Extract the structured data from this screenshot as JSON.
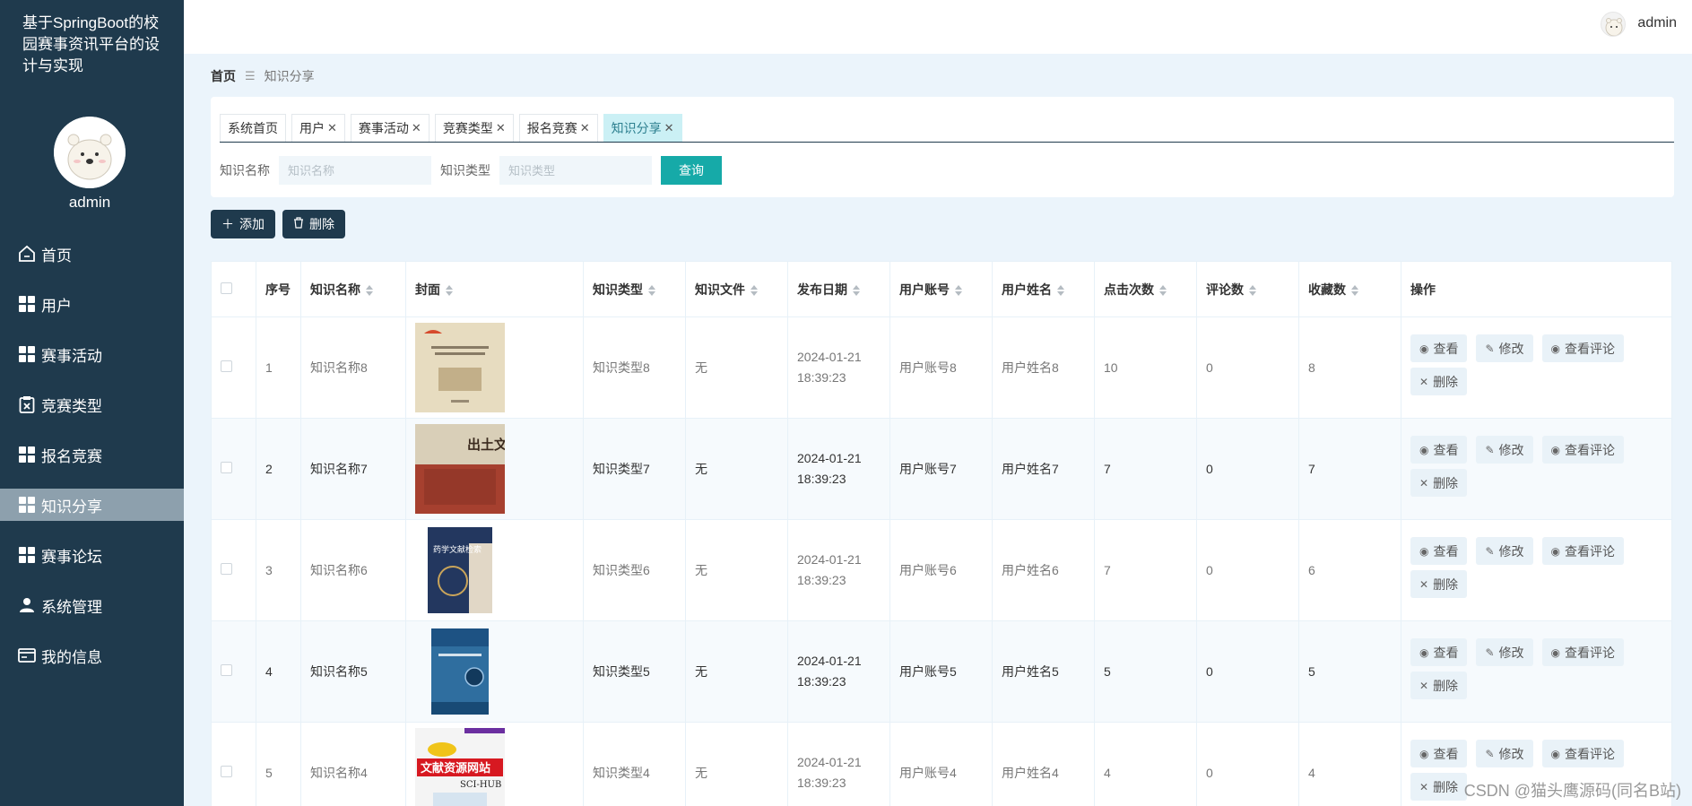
{
  "sidebar": {
    "system_title": "基于SpringBoot的校园赛事资讯平台的设计与实现",
    "username": "admin",
    "menu": [
      {
        "label": "首页",
        "icon": "home-icon"
      },
      {
        "label": "用户",
        "icon": "grid-icon"
      },
      {
        "label": "赛事活动",
        "icon": "grid-icon"
      },
      {
        "label": "竞赛类型",
        "icon": "clipboard-icon"
      },
      {
        "label": "报名竞赛",
        "icon": "grid-icon"
      },
      {
        "label": "知识分享",
        "icon": "grid-icon",
        "active": true
      },
      {
        "label": "赛事论坛",
        "icon": "grid-icon"
      },
      {
        "label": "系统管理",
        "icon": "user-icon"
      },
      {
        "label": "我的信息",
        "icon": "card-icon"
      }
    ]
  },
  "topbar": {
    "username": "admin"
  },
  "breadcrumb": {
    "home": "首页",
    "separator": "☰",
    "current": "知识分享"
  },
  "tabs": [
    {
      "label": "系统首页",
      "closable": false
    },
    {
      "label": "用户",
      "closable": true
    },
    {
      "label": "赛事活动",
      "closable": true
    },
    {
      "label": "竞赛类型",
      "closable": true
    },
    {
      "label": "报名竞赛",
      "closable": true
    },
    {
      "label": "知识分享",
      "closable": true,
      "active": true
    }
  ],
  "search": {
    "name_label": "知识名称",
    "name_placeholder": "知识名称",
    "type_label": "知识类型",
    "type_placeholder": "知识类型",
    "query_label": "查询"
  },
  "actions": {
    "add_label": "添加",
    "delete_label": "删除"
  },
  "table": {
    "headers": [
      "序号",
      "知识名称",
      "封面",
      "知识类型",
      "知识文件",
      "发布日期",
      "用户账号",
      "用户姓名",
      "点击次数",
      "评论数",
      "收藏数",
      "操作"
    ],
    "op_labels": {
      "view": "查看",
      "edit": "修改",
      "comments": "查看评论",
      "delete": "删除"
    },
    "rows": [
      {
        "index": "1",
        "name": "知识名称8",
        "type": "知识类型8",
        "file": "无",
        "date": "2024-01-21 18:39:23",
        "account": "用户账号8",
        "username": "用户姓名8",
        "clicks": "10",
        "comments": "0",
        "favorites": "8",
        "cover": "book-cover-1"
      },
      {
        "index": "2",
        "name": "知识名称7",
        "type": "知识类型7",
        "file": "无",
        "date": "2024-01-21 18:39:23",
        "account": "用户账号7",
        "username": "用户姓名7",
        "clicks": "7",
        "comments": "0",
        "favorites": "7",
        "cover": "book-cover-2"
      },
      {
        "index": "3",
        "name": "知识名称6",
        "type": "知识类型6",
        "file": "无",
        "date": "2024-01-21 18:39:23",
        "account": "用户账号6",
        "username": "用户姓名6",
        "clicks": "7",
        "comments": "0",
        "favorites": "6",
        "cover": "book-cover-3"
      },
      {
        "index": "4",
        "name": "知识名称5",
        "type": "知识类型5",
        "file": "无",
        "date": "2024-01-21 18:39:23",
        "account": "用户账号5",
        "username": "用户姓名5",
        "clicks": "5",
        "comments": "0",
        "favorites": "5",
        "cover": "book-cover-4"
      },
      {
        "index": "5",
        "name": "知识名称4",
        "type": "知识类型4",
        "file": "无",
        "date": "2024-01-21 18:39:23",
        "account": "用户账号4",
        "username": "用户姓名4",
        "clicks": "4",
        "comments": "0",
        "favorites": "4",
        "cover": "book-cover-5"
      }
    ]
  },
  "cover_texts": {
    "cover2_title": "出土文献",
    "cover3_title": "药学文献检索",
    "cover5_banner": "文献资源网站",
    "cover5_caption": "SCI-HUB"
  },
  "watermark": "CSDN @猫头鹰源码(同名B站)",
  "colors": {
    "sidebar_bg": "#1f3a4d",
    "active_menu": "#8da0ad",
    "query_button": "#16aaa8",
    "active_tab": "#cbf0f5",
    "page_bg": "#ebf4fb"
  }
}
